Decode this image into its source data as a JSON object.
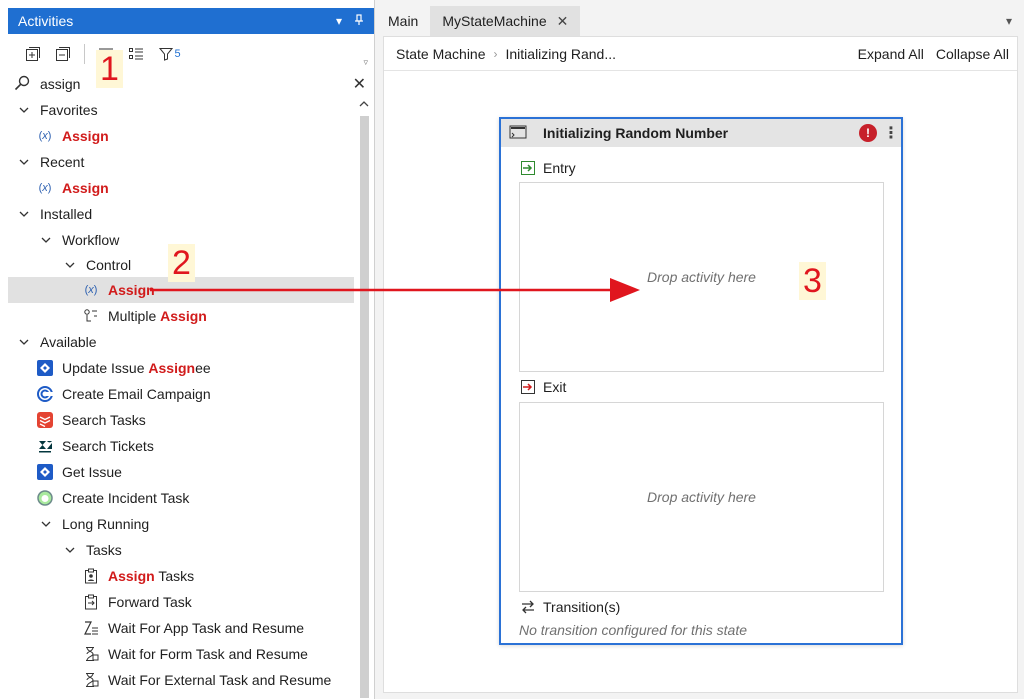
{
  "panel": {
    "title": "Activities",
    "pin_icon": "pin-icon",
    "dropdown_icon": "chevron-down-icon"
  },
  "toolbar": {
    "filter_count": "5"
  },
  "search": {
    "value": "assign"
  },
  "tree": {
    "favorites": "Favorites",
    "recent": "Recent",
    "installed": "Installed",
    "workflow": "Workflow",
    "control": "Control",
    "available": "Available",
    "long_running": "Long Running",
    "tasks": "Tasks",
    "assign": "Assign",
    "multiple_pre": "Multiple ",
    "update_issue_pre": "Update Issue ",
    "update_issue_suffix": "ee",
    "create_email_campaign": "Create Email Campaign",
    "search_tasks": "Search Tasks",
    "search_tickets": "Search Tickets",
    "get_issue": "Get Issue",
    "create_incident_task": "Create Incident Task",
    "assign_tasks_suffix": " Tasks",
    "forward_task": "Forward Task",
    "wait_app": "Wait For App Task and Resume",
    "wait_form": "Wait for Form Task and Resume",
    "wait_external": "Wait For External Task and Resume"
  },
  "tabs": {
    "main": "Main",
    "active": "MyStateMachine"
  },
  "breadcrumb": {
    "root": "State Machine",
    "current": "Initializing Rand..."
  },
  "actions": {
    "expand_all": "Expand All",
    "collapse_all": "Collapse All"
  },
  "state": {
    "title": "Initializing Random Number",
    "entry_label": "Entry",
    "exit_label": "Exit",
    "drop_hint": "Drop activity here",
    "transitions_label": "Transition(s)",
    "no_transition": "No transition configured for this state"
  },
  "annotations": {
    "step1": "1",
    "step2": "2",
    "step3": "3"
  },
  "colors": {
    "accent": "#1f6fd1",
    "highlight": "#d11b1b",
    "state_border": "#2b72d6",
    "annotation": "#e0161e"
  }
}
